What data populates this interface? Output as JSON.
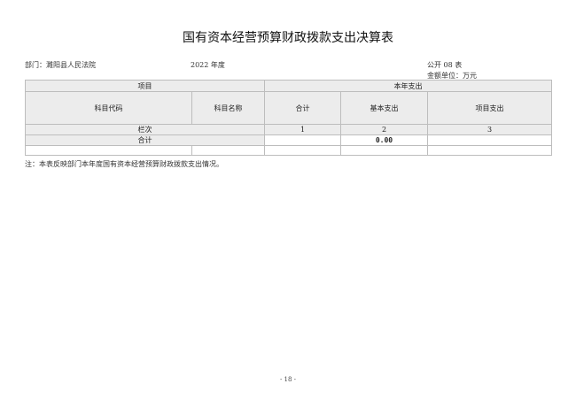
{
  "title": "国有资本经营预算财政拨款支出决算表",
  "meta": {
    "department": "部门：濉阳县人民法院",
    "year": "2022 年度",
    "form_code": "公开 08 表",
    "unit": "金额单位：万元"
  },
  "table": {
    "group_item": "项目",
    "group_current_year": "本年支出",
    "col_code": "科目代码",
    "col_name": "科目名称",
    "col_total": "合计",
    "col_basic": "基本支出",
    "col_project": "项目支出",
    "row_lanci": "栏次",
    "lanci_1": "1",
    "lanci_2": "2",
    "lanci_3": "3",
    "row_total": "合计",
    "total_total": "",
    "total_basic": "0.00",
    "total_project": ""
  },
  "note": "注：本表反映部门本年度国有资本经营预算财政拨款支出情况。",
  "page_number": "- 18 -"
}
